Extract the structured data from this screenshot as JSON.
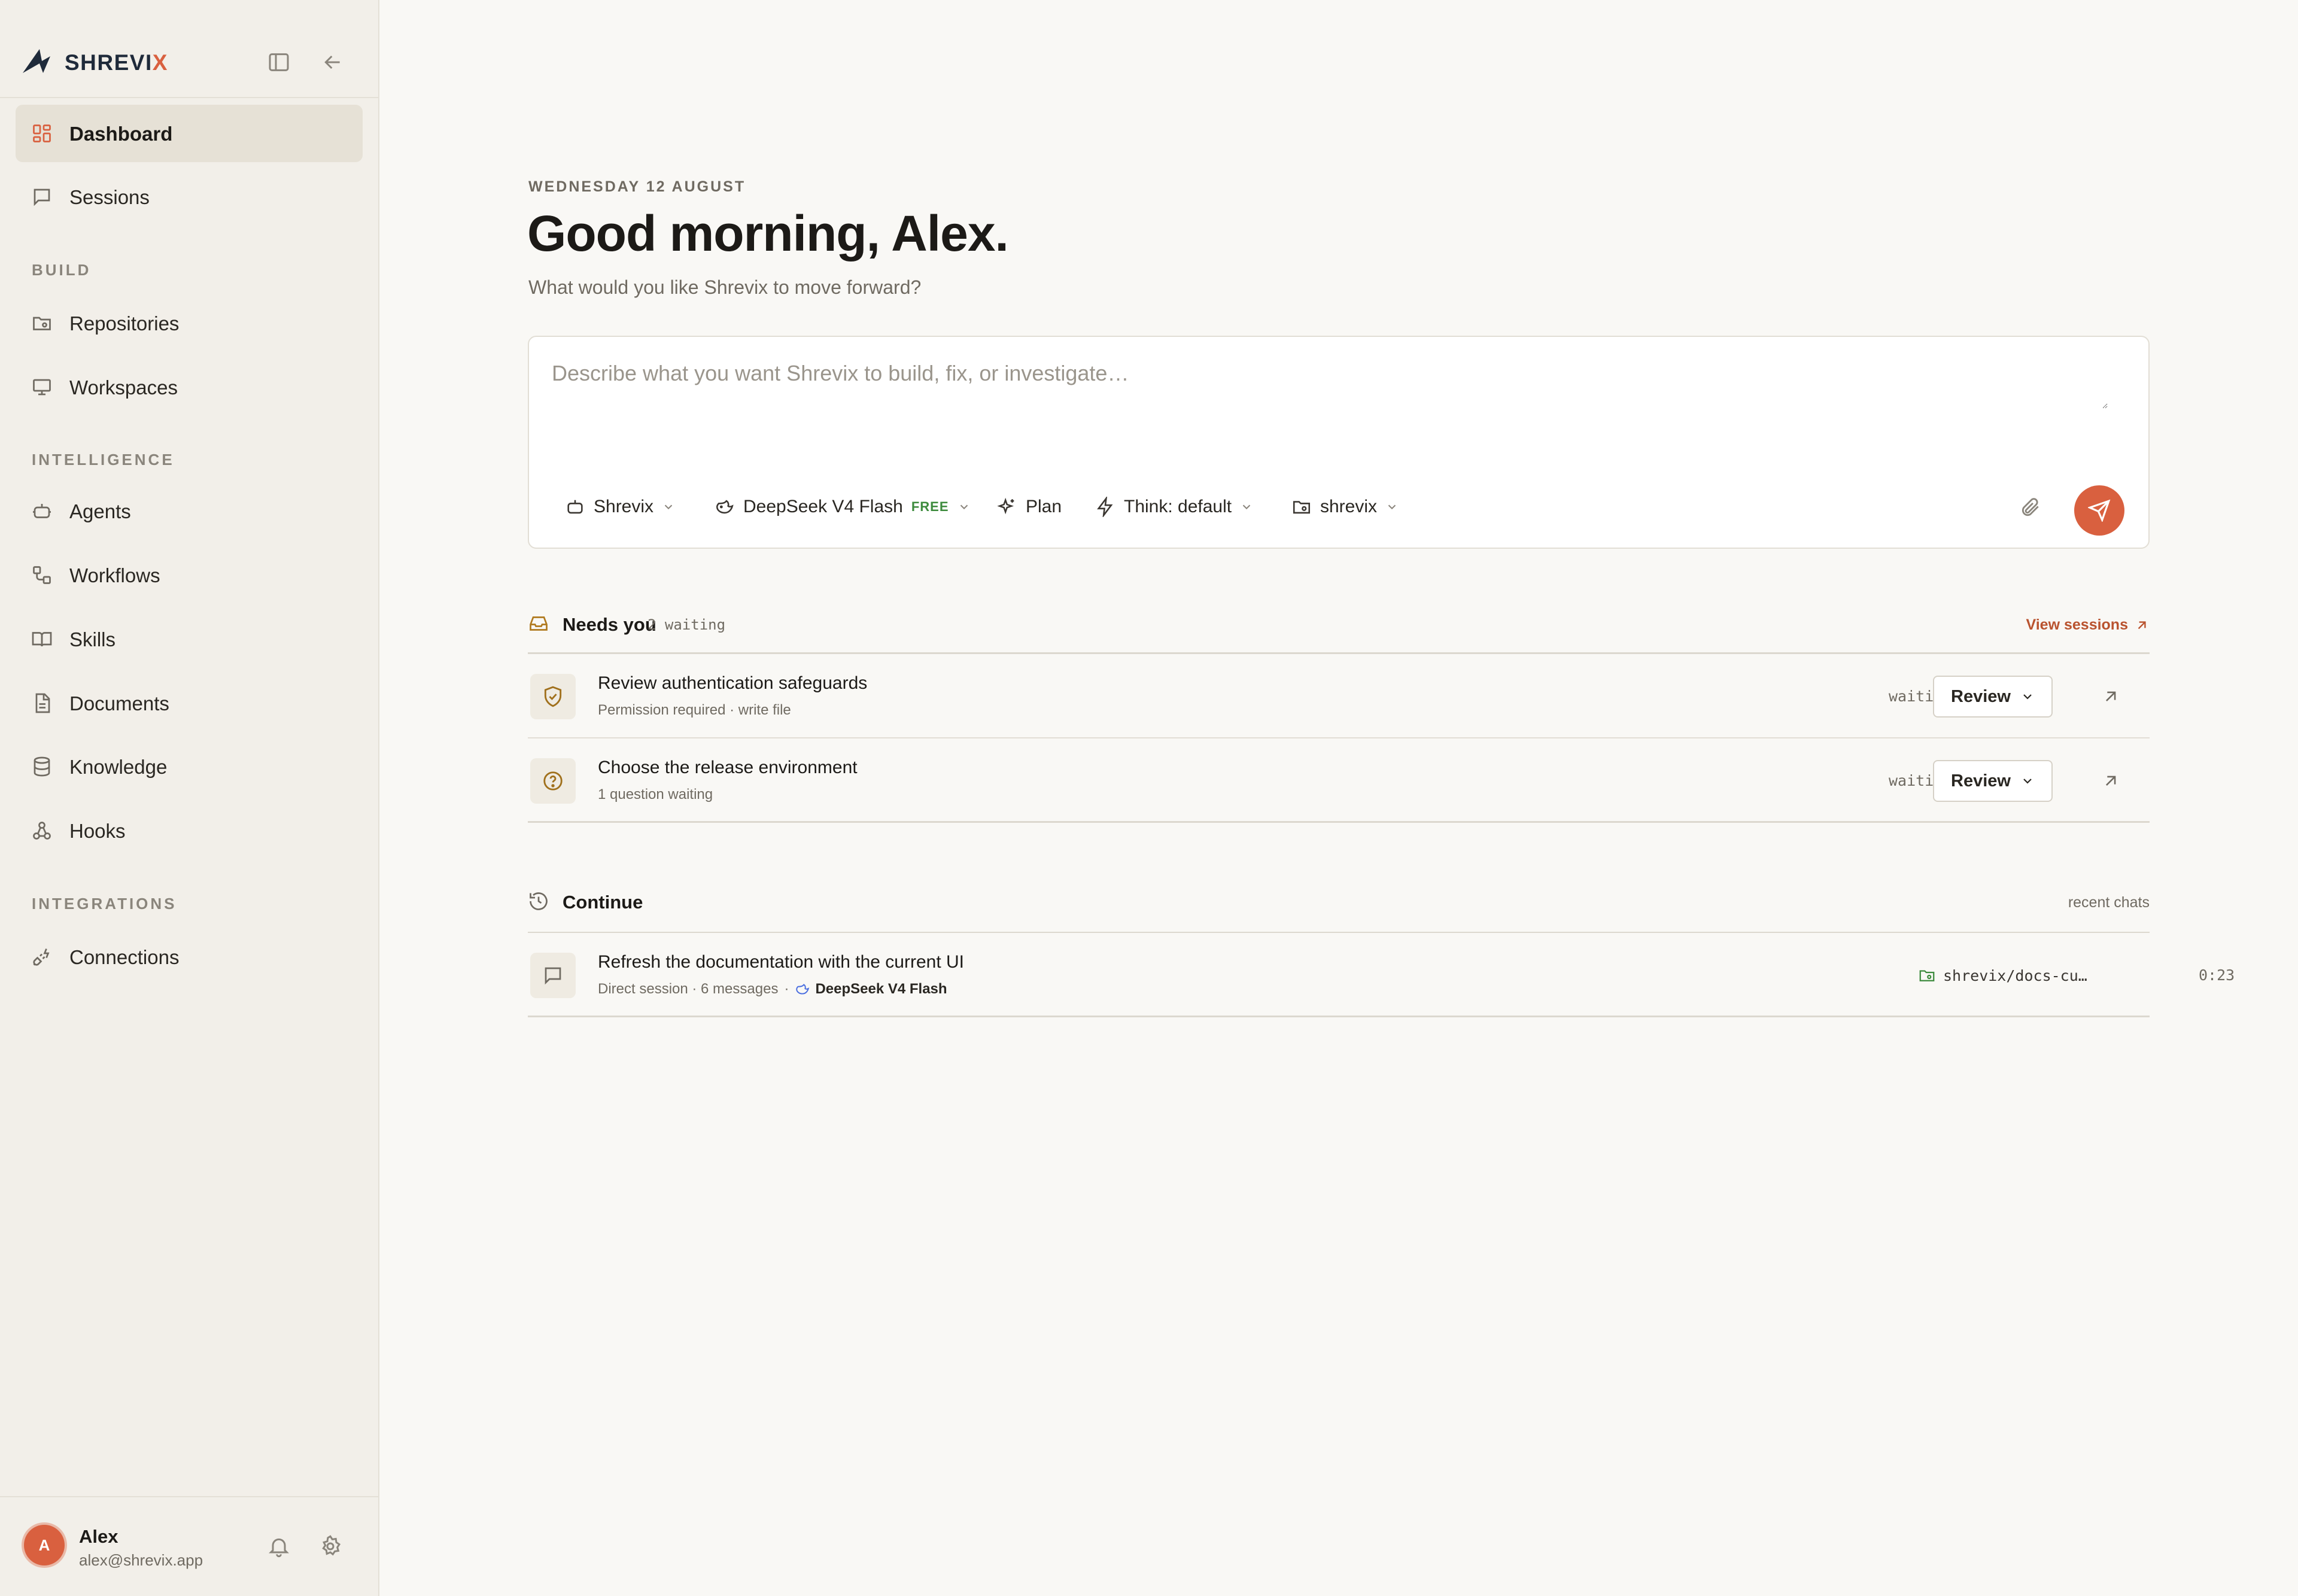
{
  "sidebar": {
    "brand": {
      "name_main": "SHREVI",
      "name_accent": "X"
    },
    "nav": [
      {
        "label": "Dashboard",
        "icon": "grid-icon",
        "active": true
      },
      {
        "label": "Sessions",
        "icon": "chat-icon"
      }
    ],
    "sections": [
      {
        "title": "BUILD",
        "items": [
          {
            "label": "Repositories",
            "icon": "repo-folder-icon"
          },
          {
            "label": "Workspaces",
            "icon": "monitor-icon"
          }
        ]
      },
      {
        "title": "INTELLIGENCE",
        "items": [
          {
            "label": "Agents",
            "icon": "robot-icon"
          },
          {
            "label": "Workflows",
            "icon": "workflow-icon"
          },
          {
            "label": "Skills",
            "icon": "book-icon"
          },
          {
            "label": "Documents",
            "icon": "document-icon"
          },
          {
            "label": "Knowledge",
            "icon": "database-icon"
          },
          {
            "label": "Hooks",
            "icon": "webhook-icon"
          }
        ]
      },
      {
        "title": "INTEGRATIONS",
        "items": [
          {
            "label": "Connections",
            "icon": "plug-icon"
          }
        ]
      }
    ],
    "user": {
      "initial": "A",
      "name": "Alex",
      "email": "alex@shrevix.app"
    }
  },
  "main": {
    "date": "WEDNESDAY 12 AUGUST",
    "greeting": "Good morning, Alex.",
    "subtitle": "What would you like Shrevix to move forward?",
    "composer": {
      "placeholder": "Describe what you want Shrevix to build, fix, or investigate…",
      "agent": "Shrevix",
      "model": "DeepSeek V4 Flash",
      "model_badge": "FREE",
      "mode": "Plan",
      "think": "Think: default",
      "repo": "shrevix"
    },
    "needs_you": {
      "title": "Needs you",
      "count": "2 waiting",
      "link": "View sessions",
      "items": [
        {
          "title": "Review authentication safeguards",
          "sub": "Permission required · write file",
          "status": "waiting",
          "action": "Review",
          "icon": "shield-check-icon"
        },
        {
          "title": "Choose the release environment",
          "sub": "1 question waiting",
          "status": "waiting",
          "action": "Review",
          "icon": "question-circle-icon"
        }
      ]
    },
    "continue": {
      "title": "Continue",
      "meta": "recent chats",
      "items": [
        {
          "title": "Refresh the documentation with the current UI",
          "sub": "Direct session · 6 messages",
          "model": "DeepSeek V4 Flash",
          "repo": "shrevix/docs-cu…",
          "time": "0:23"
        }
      ]
    }
  },
  "colors": {
    "accent": "#d9603f",
    "warning": "#b07a1f",
    "success": "#3d8b3d"
  }
}
